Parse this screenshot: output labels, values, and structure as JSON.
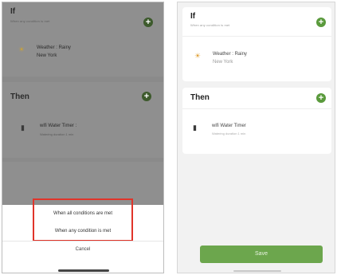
{
  "left_screen": {
    "if_section": {
      "title": "If",
      "subtitle": "When any condition is met",
      "add_icon": "plus-icon",
      "condition": {
        "icon": "sun-icon",
        "label": "Weather : Rainy",
        "location": "New York"
      }
    },
    "then_section": {
      "title": "Then",
      "add_icon": "plus-icon",
      "action": {
        "icon": "device-icon",
        "label": "wifi Water Timer :",
        "detail": "Watering duration 1 min"
      }
    },
    "action_sheet": {
      "options": [
        "When all conditions are met",
        "When any condition is met"
      ],
      "cancel_label": "Cancel",
      "highlight_color": "#e0342a"
    }
  },
  "right_screen": {
    "if_section": {
      "title": "If",
      "subtitle": "When any condition is met",
      "add_icon": "plus-icon",
      "condition": {
        "icon": "sun-icon",
        "label": "Weather : Rainy",
        "location": "New York"
      }
    },
    "then_section": {
      "title": "Then",
      "add_icon": "plus-icon",
      "action": {
        "icon": "device-icon",
        "label": "wifi Water Timer",
        "detail": "Watering duration 1 min"
      }
    },
    "save_label": "Save",
    "accent_color": "#6ca64d"
  }
}
